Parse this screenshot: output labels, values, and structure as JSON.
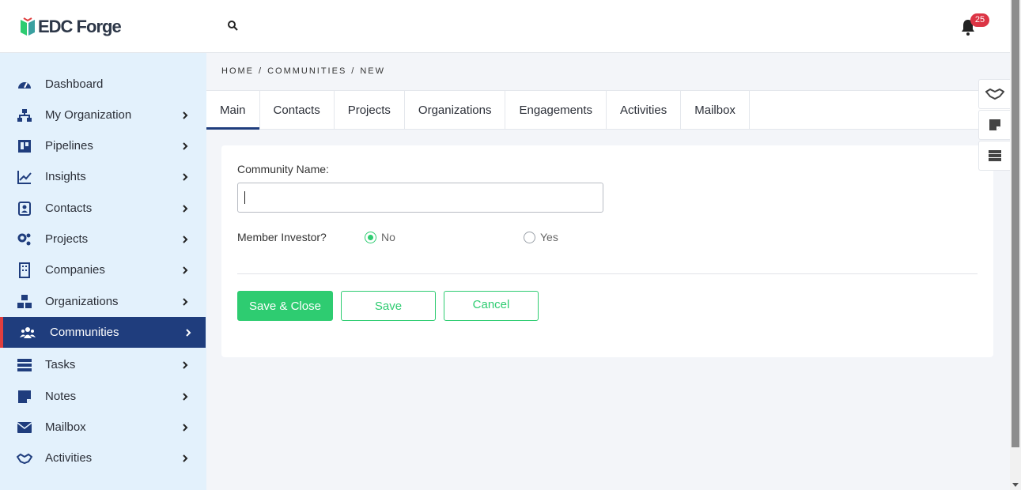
{
  "app": {
    "brand": "EDC Forge",
    "notification_count": "25",
    "colors": {
      "sidebar_bg": "#e3f1fc",
      "active_nav": "#1f3d7d",
      "accent_green": "#2ecc71",
      "badge_red": "#dc3545"
    }
  },
  "header": {
    "search_icon": "search-icon",
    "bell_icon": "bell-icon"
  },
  "sidebar": {
    "items": [
      {
        "label": "Dashboard",
        "icon": "dashboard-icon",
        "chevron": false
      },
      {
        "label": "My Organization",
        "icon": "org-chart-icon",
        "chevron": true
      },
      {
        "label": "Pipelines",
        "icon": "pipeline-icon",
        "chevron": true
      },
      {
        "label": "Insights",
        "icon": "chart-line-icon",
        "chevron": true
      },
      {
        "label": "Contacts",
        "icon": "contact-card-icon",
        "chevron": true
      },
      {
        "label": "Projects",
        "icon": "gears-icon",
        "chevron": true
      },
      {
        "label": "Companies",
        "icon": "building-icon",
        "chevron": true
      },
      {
        "label": "Organizations",
        "icon": "cubes-icon",
        "chevron": true
      },
      {
        "label": "Communities",
        "icon": "users-icon",
        "chevron": true,
        "active": true
      },
      {
        "label": "Tasks",
        "icon": "tasks-icon",
        "chevron": true
      },
      {
        "label": "Notes",
        "icon": "note-icon",
        "chevron": true
      },
      {
        "label": "Mailbox",
        "icon": "envelope-icon",
        "chevron": true
      },
      {
        "label": "Activities",
        "icon": "handshake-icon",
        "chevron": true
      }
    ]
  },
  "breadcrumb": {
    "home": "HOME",
    "sep1": "/",
    "communities": "COMMUNITIES",
    "sep2": "/",
    "current": "NEW"
  },
  "tabs": [
    "Main",
    "Contacts",
    "Projects",
    "Organizations",
    "Engagements",
    "Activities",
    "Mailbox"
  ],
  "form": {
    "community_name_label": "Community Name:",
    "community_name_value": "",
    "member_investor_label": "Member Investor?",
    "option_no": "No",
    "option_yes": "Yes",
    "selected": "No"
  },
  "buttons": {
    "save_close": "Save & Close",
    "save": "Save",
    "cancel": "Cancel"
  },
  "right_tools": [
    "handshake-icon",
    "note-icon",
    "tasks-icon"
  ]
}
